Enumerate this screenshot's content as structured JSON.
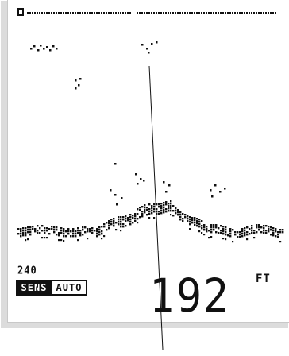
{
  "display": {
    "range": "240",
    "sensitivity_mode": "SENS",
    "range_mode": "AUTO",
    "depth": "192",
    "depth_unit": "FT"
  },
  "colors": {
    "lcd_pixel": "#111111",
    "screen_bg": "#ffffff",
    "bezel": "#dcdcdc"
  }
}
